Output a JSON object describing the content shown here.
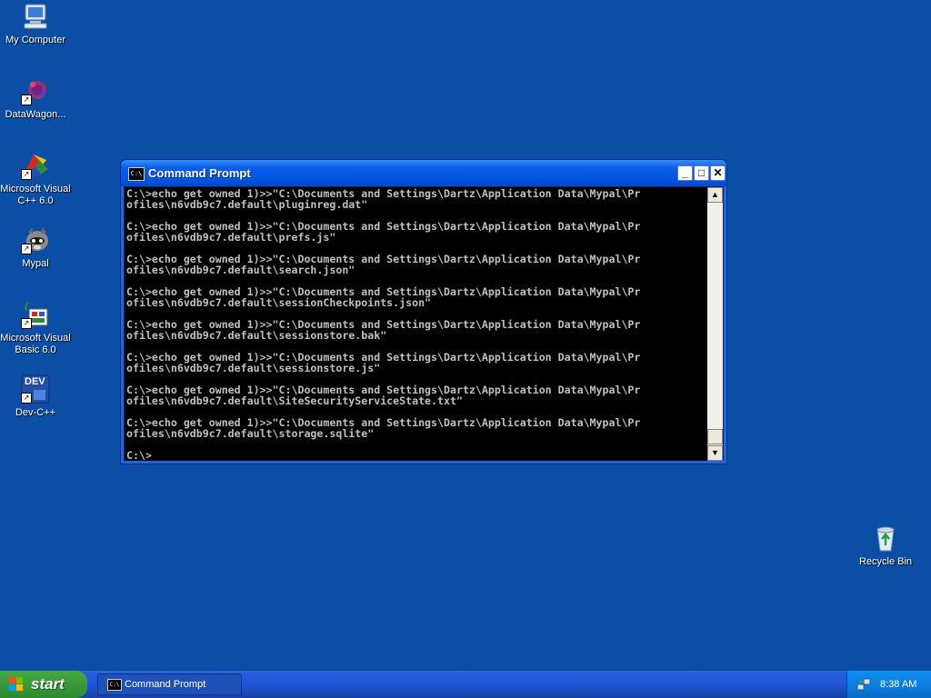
{
  "desktop": {
    "icons": [
      {
        "label": "My Computer",
        "icon": "my-computer-icon"
      },
      {
        "label": "DataWagon...",
        "icon": "datawagon-icon"
      },
      {
        "label": "Microsoft Visual C++ 6.0",
        "icon": "visual-cpp-icon"
      },
      {
        "label": "Mypal",
        "icon": "mypal-icon"
      },
      {
        "label": "Microsoft Visual Basic 6.0",
        "icon": "visual-basic-icon"
      },
      {
        "label": "Dev-C++",
        "icon": "dev-cpp-icon"
      },
      {
        "label": "Recycle Bin",
        "icon": "recycle-bin-icon"
      }
    ],
    "devcpp_badge": "DEV"
  },
  "window": {
    "title": "Command Prompt",
    "icon_text": "C:\\",
    "buttons": {
      "minimize": "_",
      "maximize": "□",
      "close": "✕"
    },
    "console_lines": [
      "C:\\>echo get owned 1)>>\"C:\\Documents and Settings\\Dartz\\Application Data\\Mypal\\Pr",
      "ofiles\\n6vdb9c7.default\\pluginreg.dat\"",
      "",
      "C:\\>echo get owned 1)>>\"C:\\Documents and Settings\\Dartz\\Application Data\\Mypal\\Pr",
      "ofiles\\n6vdb9c7.default\\prefs.js\"",
      "",
      "C:\\>echo get owned 1)>>\"C:\\Documents and Settings\\Dartz\\Application Data\\Mypal\\Pr",
      "ofiles\\n6vdb9c7.default\\search.json\"",
      "",
      "C:\\>echo get owned 1)>>\"C:\\Documents and Settings\\Dartz\\Application Data\\Mypal\\Pr",
      "ofiles\\n6vdb9c7.default\\sessionCheckpoints.json\"",
      "",
      "C:\\>echo get owned 1)>>\"C:\\Documents and Settings\\Dartz\\Application Data\\Mypal\\Pr",
      "ofiles\\n6vdb9c7.default\\sessionstore.bak\"",
      "",
      "C:\\>echo get owned 1)>>\"C:\\Documents and Settings\\Dartz\\Application Data\\Mypal\\Pr",
      "ofiles\\n6vdb9c7.default\\sessionstore.js\"",
      "",
      "C:\\>echo get owned 1)>>\"C:\\Documents and Settings\\Dartz\\Application Data\\Mypal\\Pr",
      "ofiles\\n6vdb9c7.default\\SiteSecurityServiceState.txt\"",
      "",
      "C:\\>echo get owned 1)>>\"C:\\Documents and Settings\\Dartz\\Application Data\\Mypal\\Pr",
      "ofiles\\n6vdb9c7.default\\storage.sqlite\"",
      "",
      "C:\\>"
    ]
  },
  "taskbar": {
    "start_label": "start",
    "task_button_label": "Command Prompt",
    "task_icon_text": "C:\\",
    "clock": "8:38 AM"
  },
  "colors": {
    "desktop": "#0a4ea5",
    "titlebar": "#0054e3",
    "console_bg": "#000000",
    "console_text": "#c0c0c0"
  }
}
